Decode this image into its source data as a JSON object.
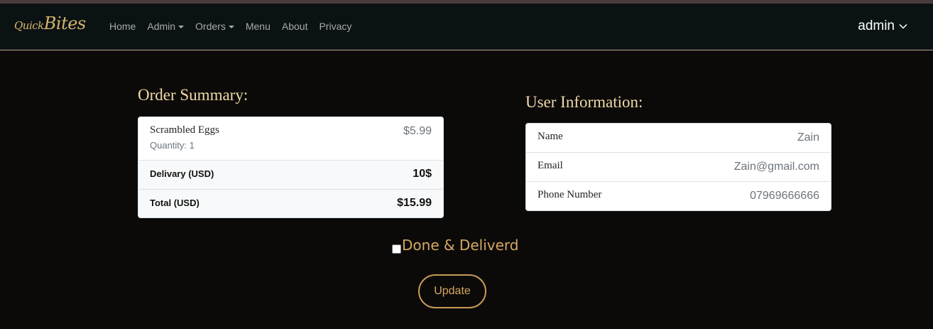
{
  "brand": {
    "small": "Quick",
    "large": "Bites"
  },
  "nav": {
    "home": "Home",
    "admin": "Admin",
    "orders": "Orders",
    "menu": "Menu",
    "about": "About",
    "privacy": "Privacy"
  },
  "user_menu": {
    "label": "admin",
    "icon": "chevron-down-icon"
  },
  "order_summary": {
    "title": "Order Summary:",
    "item": {
      "name": "Scrambled Eggs",
      "quantity": "Quantity: 1",
      "price": "$5.99"
    },
    "delivery": {
      "label": "Delivary (USD)",
      "value": "10$"
    },
    "total": {
      "label": "Total (USD)",
      "value": "$15.99"
    }
  },
  "user_info": {
    "title": "User Information:",
    "name": {
      "label": "Name",
      "value": "Zain"
    },
    "email": {
      "label": "Email",
      "value": "Zain@gmail.com"
    },
    "phone": {
      "label": "Phone Number",
      "value": "07969666666"
    }
  },
  "status": {
    "label": "Done & Deliverd",
    "checked": false
  },
  "actions": {
    "update": "Update"
  },
  "colors": {
    "background": "#0c0a09",
    "navbar": "#0b1214",
    "accent_gold": "#d4a862",
    "title_cream": "#efd9a7"
  }
}
